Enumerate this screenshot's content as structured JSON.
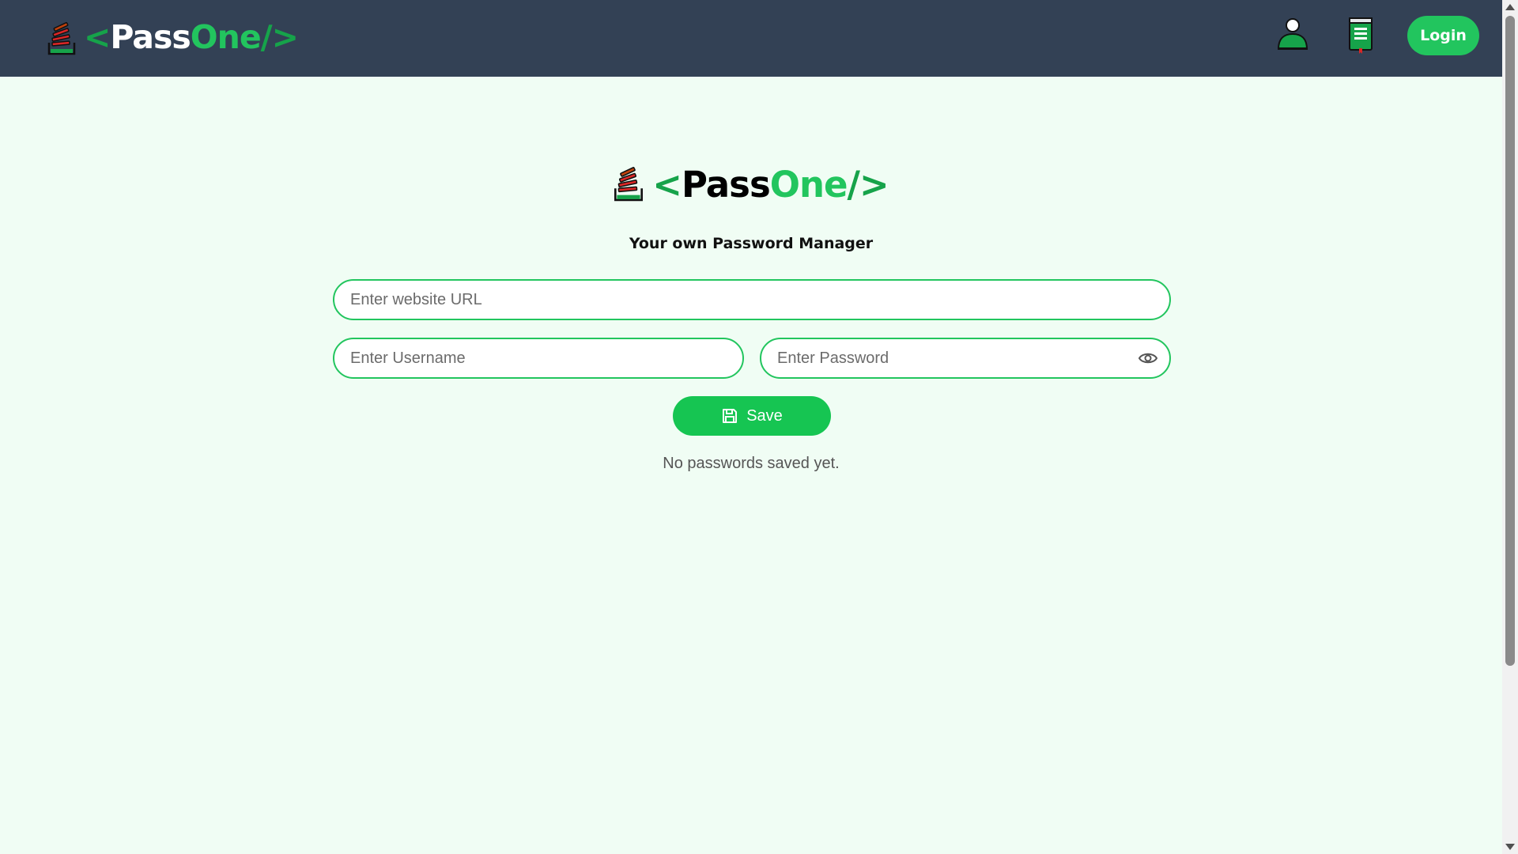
{
  "navbar": {
    "brand": {
      "open_bracket": "<",
      "pass": "Pass",
      "one": "One",
      "close_bracket": "/>"
    },
    "icons": [
      "user-icon",
      "book-icon"
    ],
    "login_label": "Login"
  },
  "hero": {
    "brand": {
      "open_bracket": "<",
      "pass": "Pass",
      "one": "One",
      "close_bracket": "/>"
    },
    "tagline": "Your own Password Manager"
  },
  "form": {
    "url_placeholder": "Enter website URL",
    "username_placeholder": "Enter Username",
    "password_placeholder": "Enter Password",
    "save_label": "Save"
  },
  "passwords": {
    "empty_message": "No passwords saved yet."
  },
  "colors": {
    "navbar_bg": "#334155",
    "page_bg": "#f0fdf4",
    "accent": "#22c55e",
    "brand_green": "#16a34a"
  }
}
